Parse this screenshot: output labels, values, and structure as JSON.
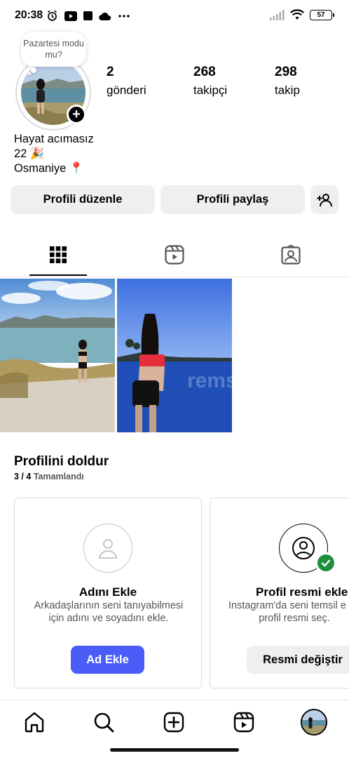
{
  "status_bar": {
    "time": "20:38",
    "battery": "57",
    "left_icons": [
      "alarm-icon",
      "youtube-icon",
      "app-icon",
      "cloud-icon",
      "more-icon"
    ],
    "right_icons": [
      "signal-icon",
      "wifi-icon",
      "battery-icon"
    ]
  },
  "profile": {
    "note": "Pazartesi modu mu?",
    "stats": [
      {
        "count": "2",
        "label": "gönderi"
      },
      {
        "count": "268",
        "label": "takipçi"
      },
      {
        "count": "298",
        "label": "takip"
      }
    ],
    "bio": [
      "Hayat acımasız",
      "22 🎉",
      "Osmaniye 📍"
    ]
  },
  "buttons": {
    "edit_profile": "Profili düzenle",
    "share_profile": "Profili paylaş"
  },
  "tabs": [
    {
      "name": "grid-icon",
      "active": true
    },
    {
      "name": "reels-icon",
      "active": false
    },
    {
      "name": "tagged-icon",
      "active": false
    }
  ],
  "posts": [
    {
      "description": "lake shore photo"
    },
    {
      "description": "sea sunset photo",
      "watermark": "remsa"
    }
  ],
  "complete_profile": {
    "title": "Profilini doldur",
    "progress_count": "3 / 4",
    "progress_label": "Tamamlandı",
    "cards": [
      {
        "title": "Adını Ekle",
        "description": "Arkadaşlarının seni tanıyabilmesi için adını ve soyadını ekle.",
        "button": "Ad Ekle"
      },
      {
        "title": "Profil resmi ekle",
        "description": "Instagram'da seni temsil e bir profil resmi seç.",
        "button": "Resmi değiştir"
      }
    ]
  },
  "bottom_nav": [
    "home-icon",
    "search-icon",
    "create-icon",
    "reels-icon",
    "profile-avatar"
  ],
  "colors": {
    "accent": "#4a5df9",
    "button_bg": "#efefef",
    "check_green": "#1e8e3e"
  }
}
